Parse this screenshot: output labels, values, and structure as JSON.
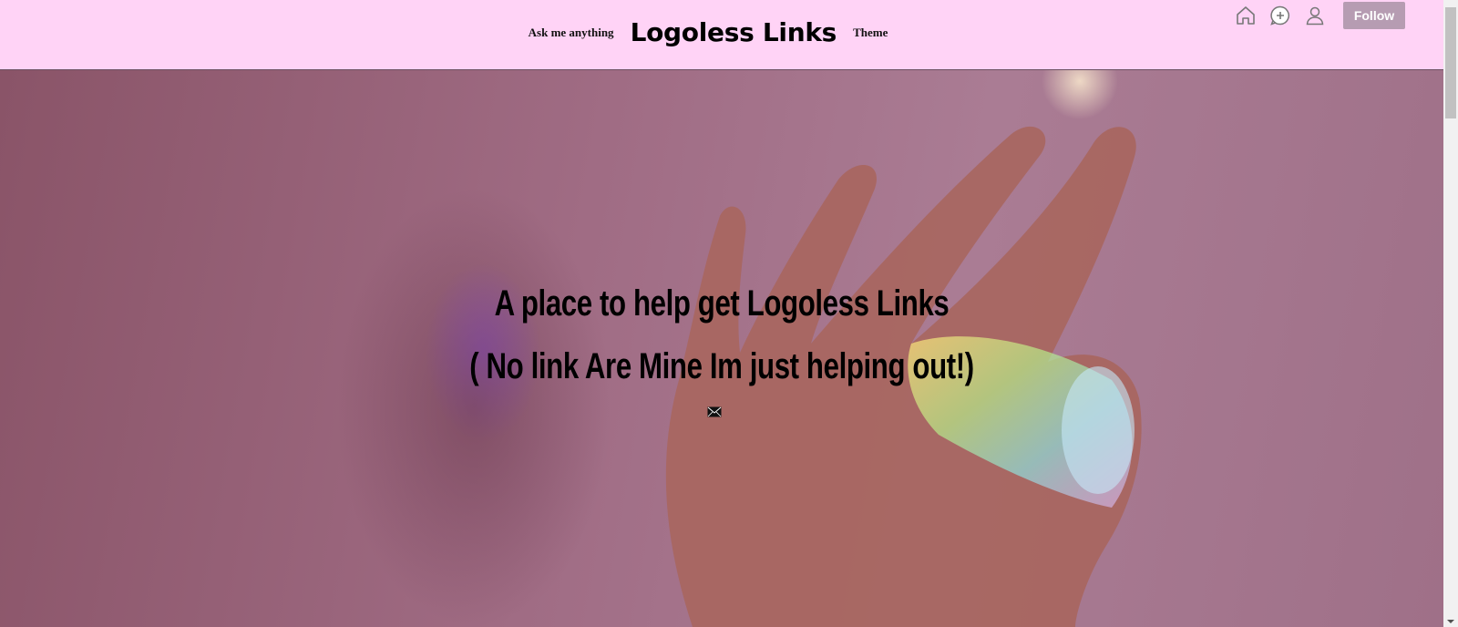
{
  "header": {
    "ask_label": "Ask me anything",
    "title": "Logoless Links",
    "theme_label": "Theme",
    "follow_label": "Follow"
  },
  "icons": {
    "home": "home-icon",
    "new_post": "plus-circle-icon",
    "account": "user-icon",
    "message": "mail-icon"
  },
  "hero": {
    "line1": "A place to help get Logoless Links",
    "line2": "( No link Are Mine Im just helping out!)"
  },
  "colors": {
    "header_bg": "#ffd3f6",
    "follow_bg": "#b69cb2",
    "hero_tint": "#9a6a80"
  }
}
